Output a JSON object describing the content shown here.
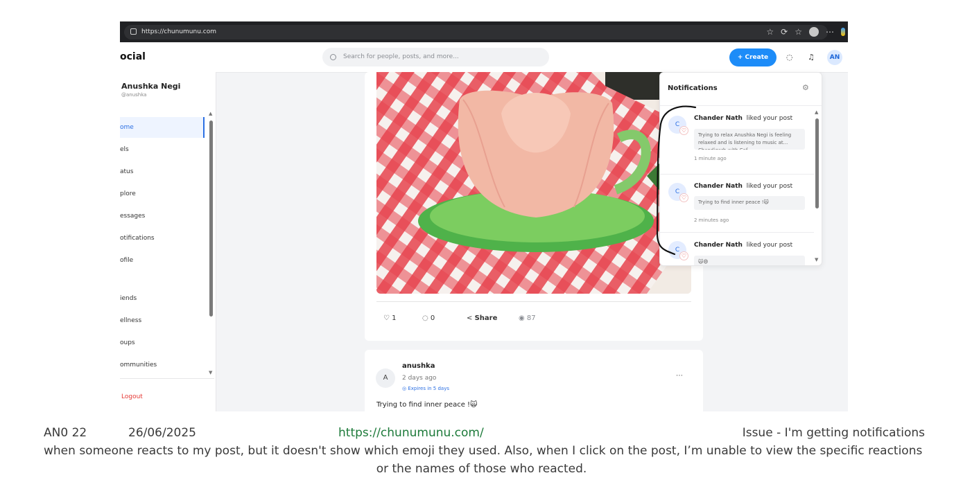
{
  "browser": {
    "url": "https://chunumunu.com"
  },
  "app": {
    "logo": "ocial",
    "search_placeholder": "Search for people, posts, and more...",
    "create_label": "+ Create",
    "user_initials": "AN"
  },
  "sidebar": {
    "user_name": "Anushka Negi",
    "user_handle": "@anushka",
    "items": [
      "ome",
      "els",
      "atus",
      "plore",
      "essages",
      "otifications",
      "ofile",
      "iends",
      "ellness",
      "oups",
      "ommunities"
    ],
    "logout": "Logout"
  },
  "post": {
    "likes": "1",
    "comments": "0",
    "share_label": "Share",
    "views": "87"
  },
  "next_post": {
    "avatar_letter": "A",
    "author": "anushka",
    "time": "2 days ago",
    "expires": "Expires in 5 days",
    "text": "Trying to find inner peace !🙀"
  },
  "notifications": {
    "title": "Notifications",
    "items": [
      {
        "avatar": "C",
        "name": "Chander Nath",
        "action": "liked your post",
        "quote": "Trying to relax Anushka Negi is feeling relaxed and is listening to music at... Chandigarh with Cef",
        "time": "1 minute ago"
      },
      {
        "avatar": "C",
        "name": "Chander Nath",
        "action": "liked your post",
        "quote": "Trying to find inner peace !🙀",
        "time": "2 minutes ago"
      },
      {
        "avatar": "C",
        "name": "Chander Nath",
        "action": "liked your post",
        "quote": "🙀😄",
        "time": ""
      }
    ]
  },
  "caption": {
    "id": "AN0 22",
    "date": "26/06/2025",
    "link": "https://chunumunu.com/",
    "issue_line1": "Issue - I'm getting notifications",
    "issue_line2": "when someone reacts to my post, but it doesn't show which emoji they used. Also, when I click on the post, I’m unable to view the specific reactions",
    "issue_line3": "or the names of those who reacted."
  },
  "colors": {
    "accent": "#1d8cf8",
    "heart": "#e53935",
    "link": "#1d7a3a",
    "annotation": "#111111"
  },
  "icons": [
    "lock-icon",
    "star-icon",
    "refresh-icon",
    "favorites-icon",
    "profile-icon",
    "more-icon",
    "search-icon",
    "messages-icon",
    "bell-icon",
    "heart-icon",
    "comment-icon",
    "share-icon",
    "eye-icon",
    "gear-icon",
    "globe-icon"
  ]
}
